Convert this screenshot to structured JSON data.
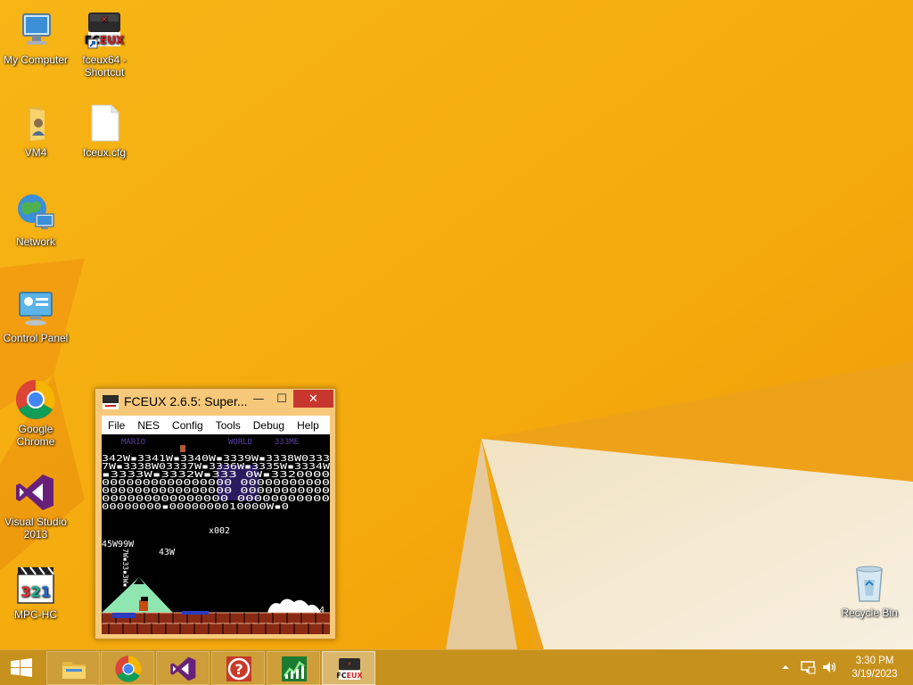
{
  "desktop": {
    "icons": [
      {
        "label": "My Computer",
        "icon": "computer-icon"
      },
      {
        "label": "fceux64 - Shortcut",
        "icon": "fceux-icon"
      },
      {
        "label": "VM4",
        "icon": "folder-user-icon"
      },
      {
        "label": "fceux.cfg",
        "icon": "file-icon"
      },
      {
        "label": "Network",
        "icon": "network-icon"
      },
      {
        "label": "Control Panel",
        "icon": "control-panel-icon"
      },
      {
        "label": "Google Chrome",
        "icon": "chrome-icon"
      },
      {
        "label": "Visual Studio 2013",
        "icon": "visual-studio-icon"
      },
      {
        "label": "MPC-HC",
        "icon": "mpc-hc-icon"
      },
      {
        "label": "Recycle Bin",
        "icon": "recycle-bin-icon"
      }
    ]
  },
  "window": {
    "title": "FCEUX 2.6.5: Super...",
    "menu": [
      "File",
      "NES",
      "Config",
      "Tools",
      "Debug",
      "Help"
    ],
    "game_screen": {
      "top_labels": [
        "MARIO",
        "WORLD",
        "333ME"
      ],
      "rows": [
        "342W▪3341W▪3340W▪3339W▪3338W0333",
        "7W▪3338W03337W▪3336W▪3335W▪3334W",
        "▪3333W▪3332W▪333     0W▪3320000",
        "0000000000000000     00000000000",
        "0000000000000000     00000000000",
        "000000000000000      00000000000",
        "00000000▪0000000010000W▪0"
      ],
      "coins": "x002",
      "left_text": "45W99W",
      "mid_text": "43W",
      "vertical_text": "7W▪33▪3W▪",
      "corner_digit": "4"
    }
  },
  "taskbar": {
    "apps": [
      "file-explorer-icon",
      "chrome-icon",
      "visual-studio-icon",
      "help-icon",
      "task-manager-icon",
      "fceux-icon"
    ],
    "clock_time": "3:30 PM",
    "clock_date": "3/19/2023"
  },
  "colors": {
    "wallpaper": "#f4ad0f",
    "taskbar": "#c7911e",
    "close": "#c7372e"
  }
}
